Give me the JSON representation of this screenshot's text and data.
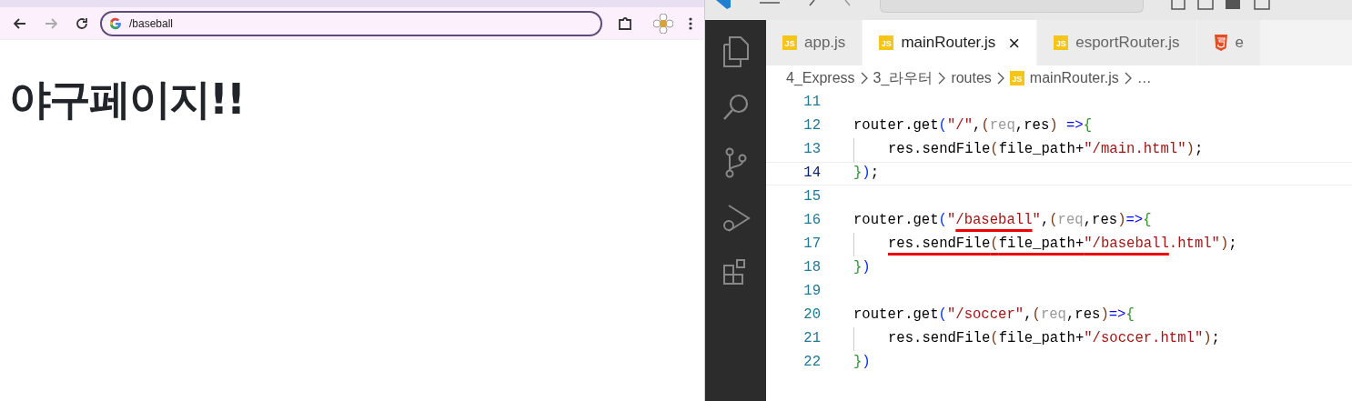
{
  "browser": {
    "nav": [
      {
        "kind": "back",
        "disabled": false
      },
      {
        "kind": "forward",
        "disabled": true
      },
      {
        "kind": "reload",
        "disabled": false
      }
    ],
    "address": {
      "value": "/baseball"
    },
    "page": {
      "heading": "야구페이지!!"
    }
  },
  "editor": {
    "tabs": [
      {
        "label": "app.js",
        "kind": "js",
        "badge": "JS",
        "selected": false
      },
      {
        "label": "mainRouter.js",
        "kind": "js",
        "badge": "JS",
        "selected": true,
        "close": "×"
      },
      {
        "label": "esportRouter.js",
        "kind": "js",
        "badge": "JS",
        "selected": false
      },
      {
        "label": "e",
        "kind": "html",
        "selected": false
      }
    ],
    "breadcrumbs": [
      {
        "label": "4_Express",
        "kind": "folder"
      },
      {
        "label": "3_라우터",
        "kind": "folder"
      },
      {
        "label": "routes",
        "kind": "folder"
      },
      {
        "label": "mainRouter.js",
        "kind": "js",
        "badge": "JS"
      },
      {
        "label": "…",
        "kind": "more"
      }
    ],
    "lines": [
      {
        "number": "11",
        "current": false
      },
      {
        "number": "12",
        "current": false,
        "tokens": [
          {
            "kind": "plain",
            "text": "router.get"
          },
          {
            "kind": "blue",
            "text": "("
          },
          {
            "kind": "string",
            "text": "\"/\""
          },
          {
            "kind": "plain",
            "text": ","
          },
          {
            "kind": "brown",
            "text": "("
          },
          {
            "kind": "unused",
            "text": "req"
          },
          {
            "kind": "plain",
            "text": ",res"
          },
          {
            "kind": "brown",
            "text": ")"
          },
          {
            "kind": "keyword",
            "text": " =>"
          },
          {
            "kind": "green",
            "text": "{"
          }
        ]
      },
      {
        "number": "13",
        "current": false,
        "indent": true,
        "tokens": [
          {
            "kind": "plain",
            "text": "res.sendFile"
          },
          {
            "kind": "brown",
            "text": "("
          },
          {
            "kind": "plain",
            "text": "file_path+"
          },
          {
            "kind": "string",
            "text": "\"/main.html\""
          },
          {
            "kind": "brown",
            "text": ")"
          },
          {
            "kind": "plain",
            "text": ";"
          }
        ]
      },
      {
        "number": "14",
        "current": true,
        "tokens": [
          {
            "kind": "green",
            "text": "}"
          },
          {
            "kind": "blue",
            "text": ")"
          },
          {
            "kind": "plain",
            "text": ";"
          }
        ]
      },
      {
        "number": "15",
        "current": false
      },
      {
        "number": "16",
        "current": false,
        "tokens": [
          {
            "kind": "plain",
            "text": "router.get"
          },
          {
            "kind": "blue",
            "text": "("
          },
          {
            "kind": "string",
            "text": "\""
          },
          {
            "kind": "string",
            "text": "/baseball",
            "underlined": true
          },
          {
            "kind": "string",
            "text": "\""
          },
          {
            "kind": "plain",
            "text": ","
          },
          {
            "kind": "brown",
            "text": "("
          },
          {
            "kind": "unused",
            "text": "req"
          },
          {
            "kind": "plain",
            "text": ",res"
          },
          {
            "kind": "brown",
            "text": ")"
          },
          {
            "kind": "keyword",
            "text": "=>"
          },
          {
            "kind": "green",
            "text": "{"
          }
        ]
      },
      {
        "number": "17",
        "current": false,
        "indent": true,
        "tokens": [
          {
            "kind": "plain",
            "text": "res.sendFile",
            "underlined": true
          },
          {
            "kind": "brown",
            "text": "(",
            "underlined": true
          },
          {
            "kind": "plain",
            "text": "file_path+",
            "underlined": true
          },
          {
            "kind": "string",
            "text": "\"/baseball",
            "underlined": true
          },
          {
            "kind": "string",
            "text": ".html\""
          },
          {
            "kind": "brown",
            "text": ")"
          },
          {
            "kind": "plain",
            "text": ";"
          }
        ]
      },
      {
        "number": "18",
        "current": false,
        "tokens": [
          {
            "kind": "green",
            "text": "}"
          },
          {
            "kind": "blue",
            "text": ")"
          }
        ]
      },
      {
        "number": "19",
        "current": false
      },
      {
        "number": "20",
        "current": false,
        "tokens": [
          {
            "kind": "plain",
            "text": "router.get"
          },
          {
            "kind": "blue",
            "text": "("
          },
          {
            "kind": "string",
            "text": "\"/soccer\""
          },
          {
            "kind": "plain",
            "text": ","
          },
          {
            "kind": "brown",
            "text": "("
          },
          {
            "kind": "unused",
            "text": "req"
          },
          {
            "kind": "plain",
            "text": ",res"
          },
          {
            "kind": "brown",
            "text": ")"
          },
          {
            "kind": "keyword",
            "text": "=>"
          },
          {
            "kind": "green",
            "text": "{"
          }
        ]
      },
      {
        "number": "21",
        "current": false,
        "indent": true,
        "tokens": [
          {
            "kind": "plain",
            "text": "res.sendFile"
          },
          {
            "kind": "brown",
            "text": "("
          },
          {
            "kind": "plain",
            "text": "file_path+"
          },
          {
            "kind": "string",
            "text": "\"/soccer.html\""
          },
          {
            "kind": "brown",
            "text": ")"
          },
          {
            "kind": "plain",
            "text": ";"
          }
        ]
      },
      {
        "number": "22",
        "current": false,
        "tokens": [
          {
            "kind": "green",
            "text": "}"
          },
          {
            "kind": "blue",
            "text": ")"
          }
        ]
      }
    ]
  }
}
